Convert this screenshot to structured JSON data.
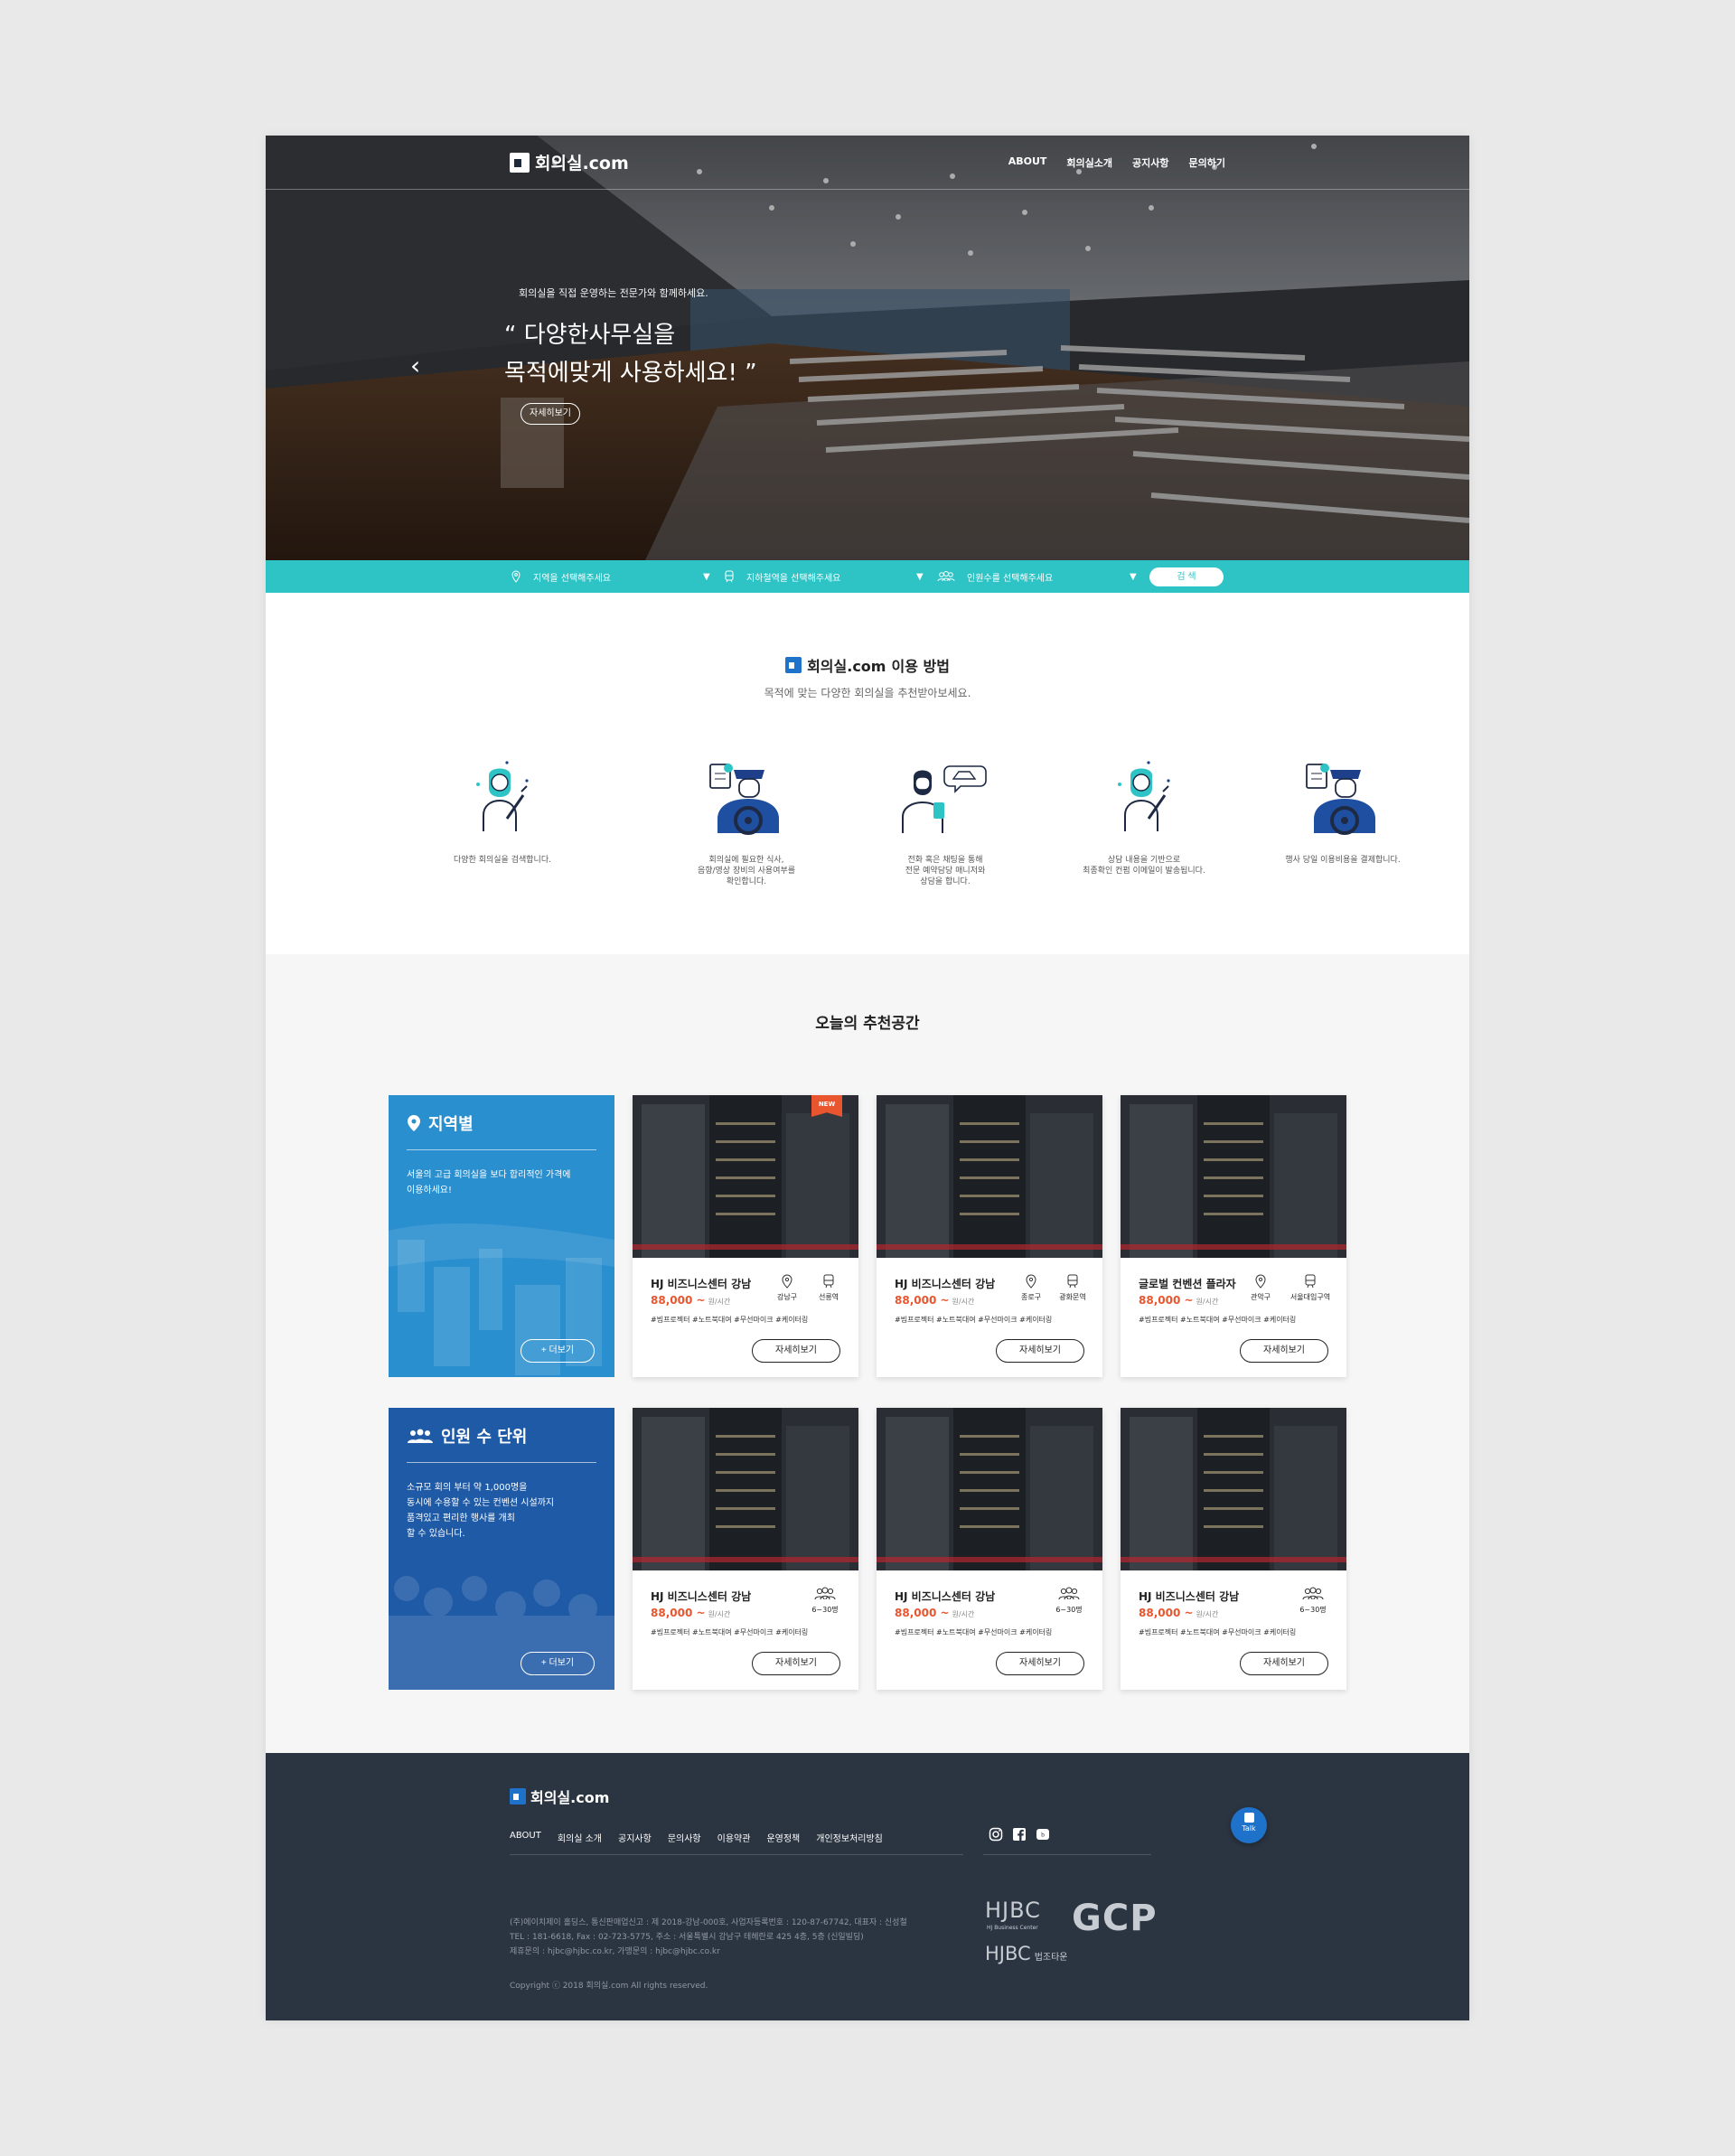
{
  "header": {
    "logo_text": "회의실.com",
    "nav": [
      "ABOUT",
      "회의실소개",
      "공지사항",
      "문의하기"
    ]
  },
  "hero": {
    "subtitle": "회의실을 직접 운영하는 전문가와 함께하세요.",
    "title_line1": "“ 다양한사무실을",
    "title_line2": "목적에맞게 사용하세요! ”",
    "detail_button": "자세히보기",
    "prev_arrow": "‹"
  },
  "search": {
    "region_placeholder": "지역을 선택해주세요",
    "subway_placeholder": "지하철역을 선택해주세요",
    "people_placeholder": "인원수를 선택해주세요",
    "search_button": "검 색",
    "caret": "▼"
  },
  "howto": {
    "title_logo": "회의실.com",
    "title_text": "이용 방법",
    "subtitle": "목적에 맞는 다양한 회의실을 추천받아보세요.",
    "steps": [
      {
        "icon": "woman-pointing-icon",
        "line1": "다양한 회의실을 검색합니다.",
        "line2": "",
        "line3": ""
      },
      {
        "icon": "driver-clipboard-icon",
        "line1": "회의실에 필요한 식사,",
        "line2": "음향/영상 장비의 사용여부를",
        "line3": "확인합니다."
      },
      {
        "icon": "man-chat-car-icon",
        "line1": "전화 혹은 채팅을 통해",
        "line2": "전문 예약담당 매니저와",
        "line3": "상담을 합니다."
      },
      {
        "icon": "woman-pointing-icon",
        "line1": "상담 내용을 기반으로",
        "line2": "최종확인 컨펌 이메일이 발송됩니다.",
        "line3": ""
      },
      {
        "icon": "driver-clipboard-icon",
        "line1": "행사 당일 이용비용을 결제합니다.",
        "line2": "",
        "line3": ""
      }
    ]
  },
  "recommend": {
    "title": "오늘의 추천공간",
    "categories": [
      {
        "title": "지역별",
        "desc1": "서울의 고급 회의실을 보다 합리적인 가격에",
        "desc2": "이용하세요!",
        "desc3": "",
        "desc4": "",
        "more": "+ 더보기",
        "color": "#2a8fcf"
      },
      {
        "title": "인원 수 단위",
        "desc1": "소규모 회의 부터 약 1,000명을",
        "desc2": "동시에 수용할 수 있는 컨벤션 시설까지",
        "desc3": "품격있고 편리한 행사를 개최",
        "desc4": "할 수 있습니다.",
        "more": "+ 더보기",
        "color": "#1e5aa6"
      }
    ],
    "cards_row1": [
      {
        "name": "HJ 비즈니스센터 강남",
        "price": "88,000 ~",
        "unit": "원/시간",
        "tags": "#빔프로젝터 #노트북대여 #무선마이크 #케이터링",
        "loc1": "강남구",
        "loc2": "선릉역",
        "new": "NEW",
        "button": "자세히보기"
      },
      {
        "name": "HJ 비즈니스센터 강남",
        "price": "88,000 ~",
        "unit": "원/시간",
        "tags": "#빔프로젝터 #노트북대여 #무선마이크 #케이터링",
        "loc1": "종로구",
        "loc2": "광화문역",
        "new": "",
        "button": "자세히보기"
      },
      {
        "name": "글로벌 컨벤션 플라자",
        "price": "88,000 ~",
        "unit": "원/시간",
        "tags": "#빔프로젝터 #노트북대여 #무선마이크 #케이터링",
        "loc1": "관악구",
        "loc2": "서울대입구역",
        "new": "",
        "button": "자세히보기"
      }
    ],
    "cards_row2": [
      {
        "name": "HJ 비즈니스센터 강남",
        "price": "88,000 ~",
        "unit": "원/시간",
        "tags": "#빔프로젝터 #노트북대여 #무선마이크 #케이터링",
        "people": "6~30명",
        "button": "자세히보기"
      },
      {
        "name": "HJ 비즈니스센터 강남",
        "price": "88,000 ~",
        "unit": "원/시간",
        "tags": "#빔프로젝터 #노트북대여 #무선마이크 #케이터링",
        "people": "6~30명",
        "button": "자세히보기"
      },
      {
        "name": "HJ 비즈니스센터 강남",
        "price": "88,000 ~",
        "unit": "원/시간",
        "tags": "#빔프로젝터 #노트북대여 #무선마이크 #케이터링",
        "people": "6~30명",
        "button": "자세히보기"
      }
    ]
  },
  "footer": {
    "logo_text": "회의실.com",
    "nav": [
      "ABOUT",
      "회의실 소개",
      "공지사항",
      "문의사항",
      "이용약관",
      "운영정책",
      "개인정보처리방침"
    ],
    "info1": "(주)에이치제이 홀딩스, 통신판매업신고 : 제 2018-강남-000호, 사업자등록번호 : 120-87-67742, 대표자 : 신성철",
    "info2": "TEL : 181-6618, Fax : 02-723-5775, 주소 : 서울특별시 강남구 테헤란로 425 4층, 5층 (신일빌딩)",
    "info3": "제휴문의 : hjbc@hjbc.co.kr, 가맹문의 : hjbc@hjbc.co.kr",
    "copyright": "Copyright ⓒ 2018 회의실.com All rights reserved.",
    "talk": "Talk",
    "brand1": "HJBC",
    "brand1_sub": "HJ Business Center",
    "brand2": "GCP",
    "brand3": "HJBC",
    "brand3_sub": "법조타운"
  },
  "colors": {
    "accent_teal": "#2ec4c6",
    "accent_blue": "#1f72c9",
    "price_orange": "#e8552e",
    "footer_bg": "#2b3441"
  }
}
